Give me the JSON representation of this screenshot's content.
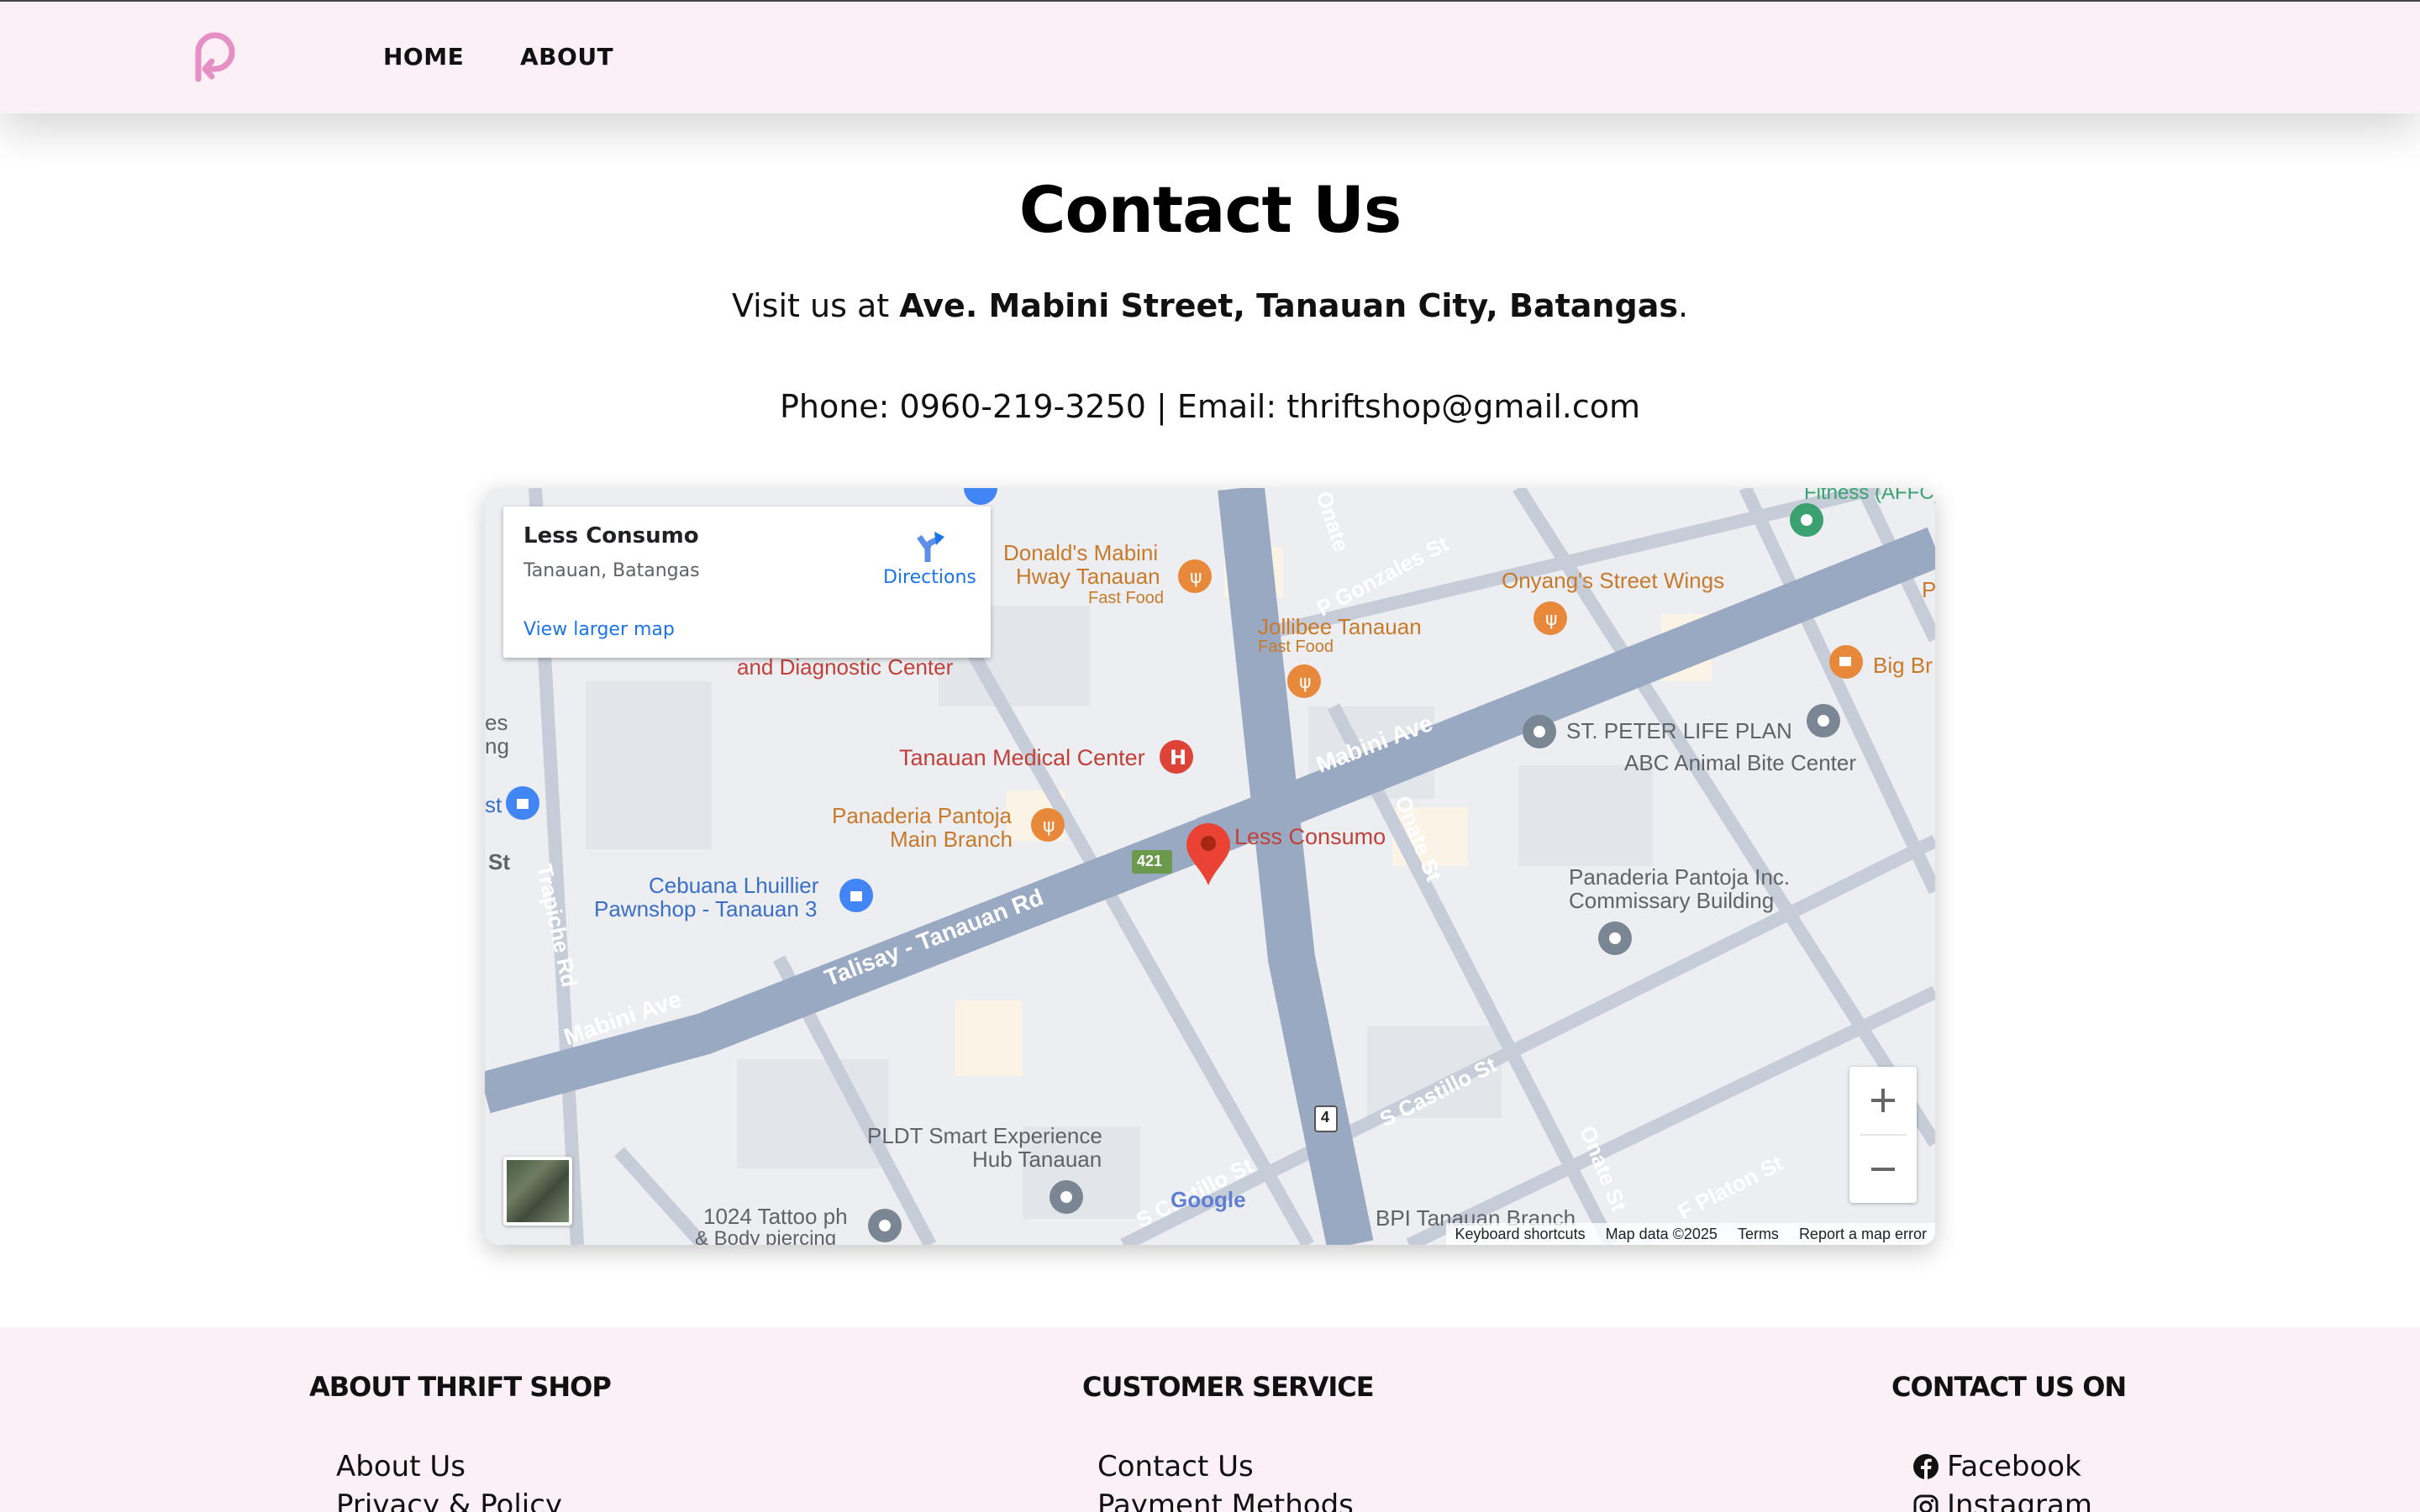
{
  "header": {
    "nav": {
      "home": "HOME",
      "about": "ABOUT"
    }
  },
  "main": {
    "title": "Contact Us",
    "visit_prefix": "Visit us at ",
    "address": "Ave. Mabini Street, Tanauan City, Batangas",
    "visit_suffix": ".",
    "phone_line": "Phone: 0960-219-3250 | Email: thriftshop@gmail.com"
  },
  "map": {
    "info_card": {
      "name": "Less Consumo",
      "address": "Tanauan, Batangas",
      "directions": "Directions",
      "larger_map": "View larger map"
    },
    "labels": {
      "mcdonalds": "Donald's Mabini",
      "mcdonalds2": "Hway Tanauan",
      "fast_food_1": "Fast Food",
      "jollibee": "Jollibee Tanauan",
      "fast_food_2": "Fast Food",
      "onyangs": "Onyang's Street Wings",
      "diagnostic": "and Diagnostic Center",
      "medical_center": "Tanauan Medical Center",
      "panaderia_1": "Panaderia Pantoja",
      "panaderia_2": "Main Branch",
      "less_consumo": "Less Consumo",
      "st_peter": "ST. PETER LIFE PLAN",
      "abc": "ABC Animal Bite Center",
      "panaderia_inc_1": "Panaderia Pantoja Inc.",
      "panaderia_inc_2": "Commissary Building",
      "cebuana_1": "Cebuana Lhuillier",
      "cebuana_2": "Pawnshop - Tanauan 3",
      "pldt_1": "PLDT Smart Experience",
      "pldt_2": "Hub Tanauan",
      "tattoo_1": "1024 Tattoo ph",
      "tattoo_2": "& Body piercing",
      "bpi": "BPI Tanauan Branch",
      "fitness": "Fitness (AFFC)",
      "big_br": "Big Br",
      "p_edge": "P",
      "es": "es",
      "ng": "ng",
      "st_left": "St",
      "st_left2": "st",
      "road_mabini_1": "Mabini Ave",
      "road_mabini_2": "Mabini Ave",
      "road_talisay": "Talisay - Tanauan Rd",
      "road_gonzales": "P Gonzales St",
      "road_onate_top": "Onate",
      "road_onate_mid": "Onate St",
      "road_onate_bot": "Onate St",
      "road_trapiche": "Trapiche Rd",
      "road_castillo_1": "S Castillo St",
      "road_castillo_2": "S Castillo St",
      "road_platon": "F Platon St",
      "route_421": "421",
      "route_4": "4"
    },
    "google": "Google",
    "attribution": {
      "shortcuts": "Keyboard shortcuts",
      "map_data": "Map data ©2025",
      "terms": "Terms",
      "report": "Report a map error"
    }
  },
  "footer": {
    "about_heading": "ABOUT THRIFT SHOP",
    "about_links": [
      "About Us",
      "Privacy & Policy"
    ],
    "service_heading": "CUSTOMER SERVICE",
    "service_links": [
      "Contact Us",
      "Payment Methods"
    ],
    "contact_heading": "CONTACT US ON",
    "social": [
      "Facebook",
      "Instagram"
    ]
  },
  "colors": {
    "header_bg": "#fbf0f6",
    "logo_pink": "#e58fc5",
    "road_major": "#9aa9c2",
    "map_bg": "#eceef2",
    "link_blue": "#1a73e8",
    "poi_orange": "#e8883a",
    "poi_red": "#db4437",
    "poi_blue": "#4285f4",
    "poi_gray": "#7b8694",
    "poi_green": "#3ba170"
  }
}
